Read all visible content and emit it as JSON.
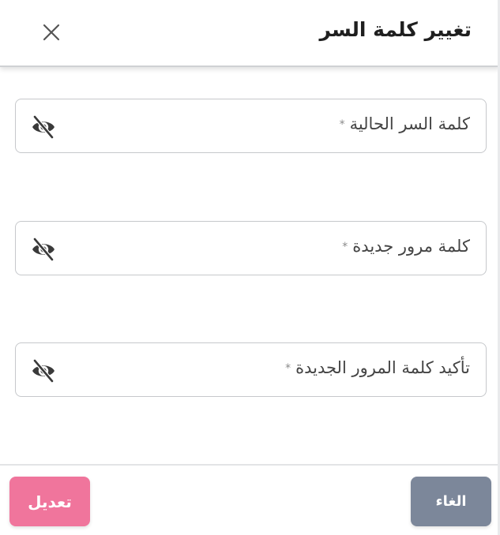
{
  "header": {
    "title": "تغيير كلمة السر"
  },
  "fields": [
    {
      "label": "كلمة السر الحالية",
      "required_mark": "*",
      "value": "",
      "icon": "eye-off-icon"
    },
    {
      "label": "كلمة مرور جديدة",
      "required_mark": "*",
      "value": "",
      "icon": "eye-off-icon"
    },
    {
      "label": "تأكيد كلمة المرور الجديدة",
      "required_mark": "*",
      "value": "",
      "icon": "eye-off-icon"
    }
  ],
  "footer": {
    "cancel_label": "الغاء",
    "submit_label": "تعديل"
  },
  "colors": {
    "cancel_button": "#7c879a",
    "submit_button": "#f0759c",
    "border": "#c6c8cb",
    "title_text": "#1f1f1f"
  }
}
